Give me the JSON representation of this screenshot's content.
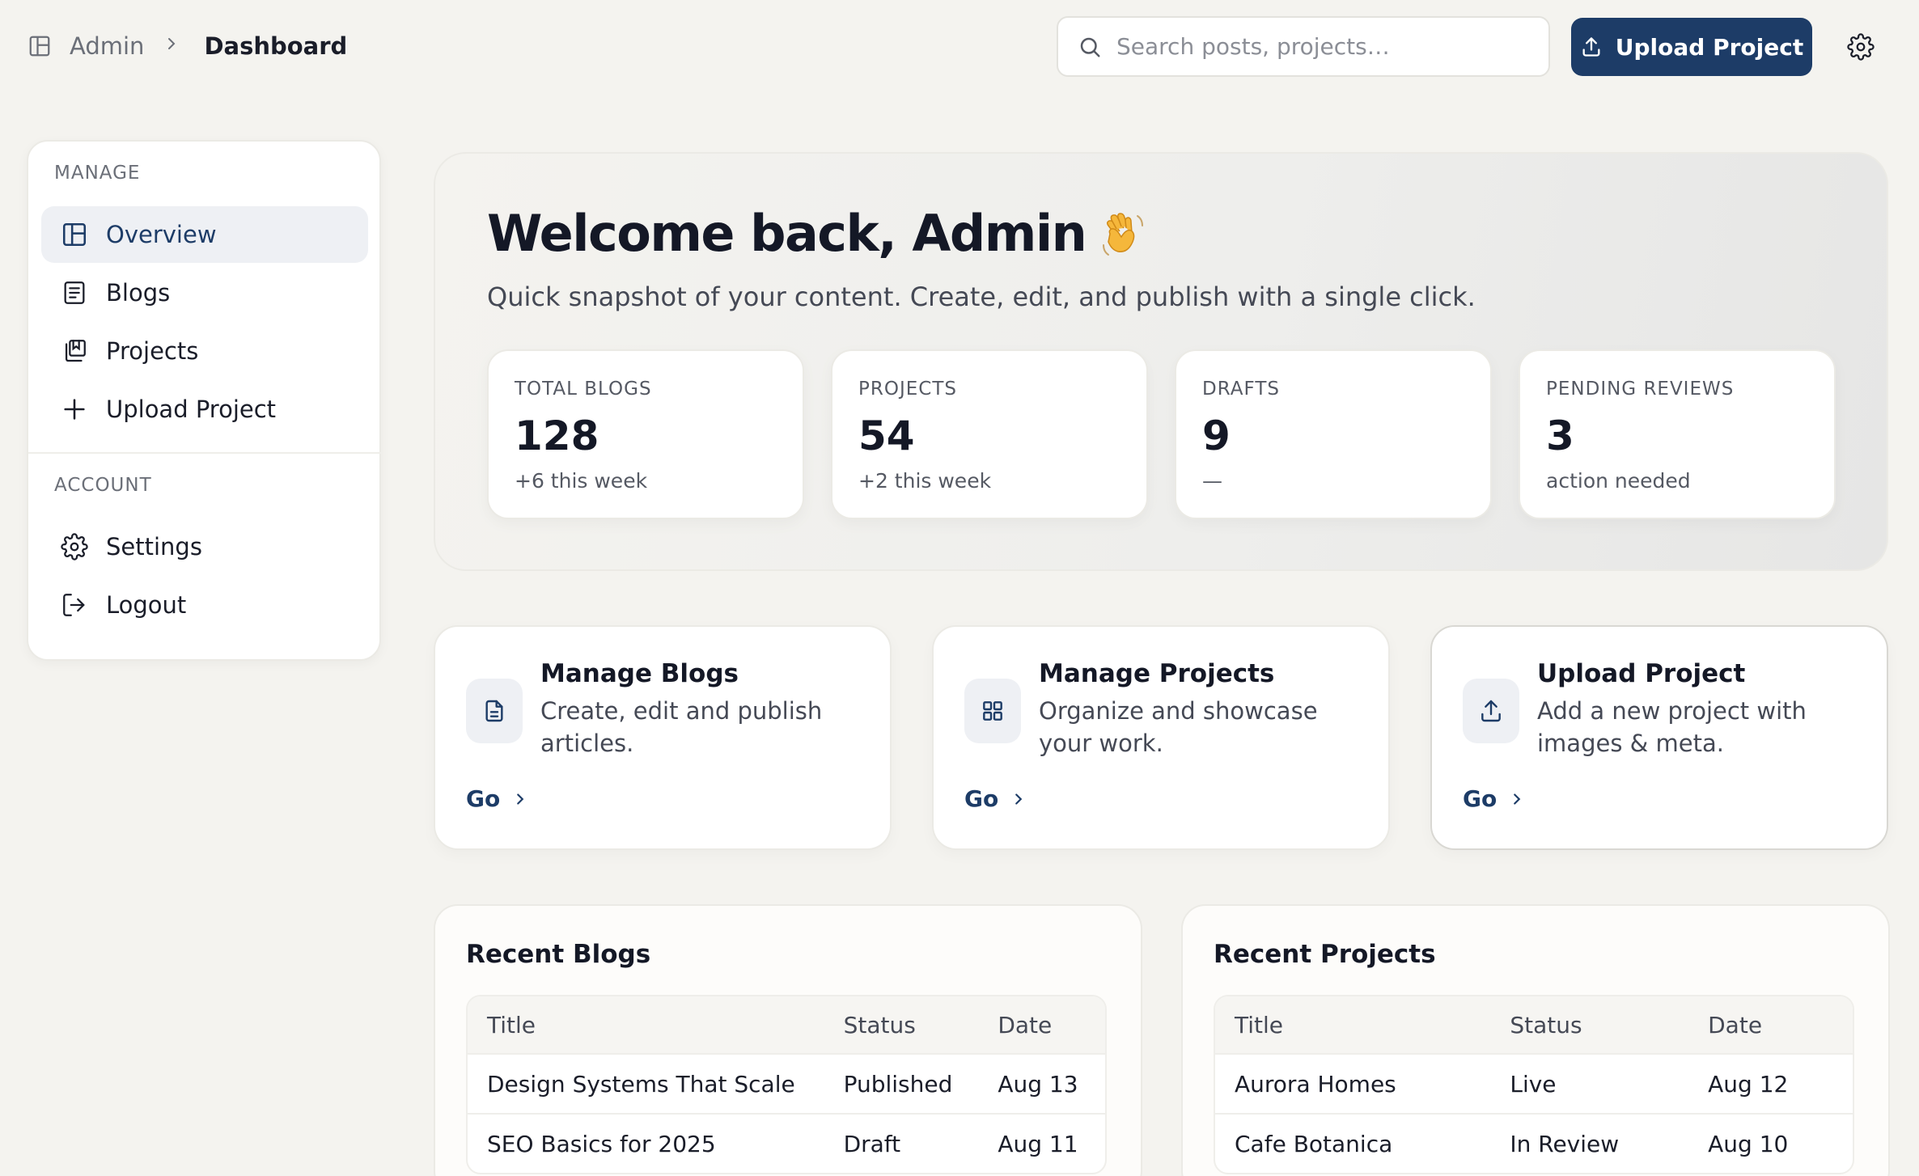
{
  "breadcrumb": {
    "root": "Admin",
    "current": "Dashboard"
  },
  "search": {
    "placeholder": "Search posts, projects…",
    "value": ""
  },
  "header": {
    "upload_label": "Upload Project"
  },
  "sidebar": {
    "manage_title": "MANAGE",
    "account_title": "ACCOUNT",
    "manage_items": [
      {
        "label": "Overview",
        "icon": "layout-icon",
        "active": true
      },
      {
        "label": "Blogs",
        "icon": "document-icon"
      },
      {
        "label": "Projects",
        "icon": "stack-icon"
      },
      {
        "label": "Upload Project",
        "icon": "plus-icon"
      }
    ],
    "account_items": [
      {
        "label": "Settings",
        "icon": "gear-icon"
      },
      {
        "label": "Logout",
        "icon": "logout-icon"
      }
    ]
  },
  "hero": {
    "title": "Welcome back, Admin",
    "emoji": "waving-hand-icon",
    "subtitle": "Quick snapshot of your content. Create, edit, and publish with a single click."
  },
  "stats": [
    {
      "label": "TOTAL BLOGS",
      "value": "128",
      "note": "+6 this week"
    },
    {
      "label": "PROJECTS",
      "value": "54",
      "note": "+2 this week"
    },
    {
      "label": "DRAFTS",
      "value": "9",
      "note": "—"
    },
    {
      "label": "PENDING REVIEWS",
      "value": "3",
      "note": "action needed"
    }
  ],
  "actions": [
    {
      "title": "Manage Blogs",
      "desc": "Create, edit and publish articles.",
      "go": "Go",
      "icon": "file-icon"
    },
    {
      "title": "Manage Projects",
      "desc": "Organize and showcase your work.",
      "go": "Go",
      "icon": "grid-icon"
    },
    {
      "title": "Upload Project",
      "desc": "Add a new project with images & meta.",
      "go": "Go",
      "icon": "upload-icon"
    }
  ],
  "recent_blogs": {
    "title": "Recent Blogs",
    "columns": [
      "Title",
      "Status",
      "Date"
    ],
    "rows": [
      [
        "Design Systems That Scale",
        "Published",
        "Aug 13"
      ],
      [
        "SEO Basics for 2025",
        "Draft",
        "Aug 11"
      ]
    ]
  },
  "recent_projects": {
    "title": "Recent Projects",
    "columns": [
      "Title",
      "Status",
      "Date"
    ],
    "rows": [
      [
        "Aurora Homes",
        "Live",
        "Aug 12"
      ],
      [
        "Cafe Botanica",
        "In Review",
        "Aug 10"
      ]
    ]
  },
  "colors": {
    "accent": "#1d3c67",
    "background": "#f4f3ef",
    "card": "#ffffff"
  }
}
